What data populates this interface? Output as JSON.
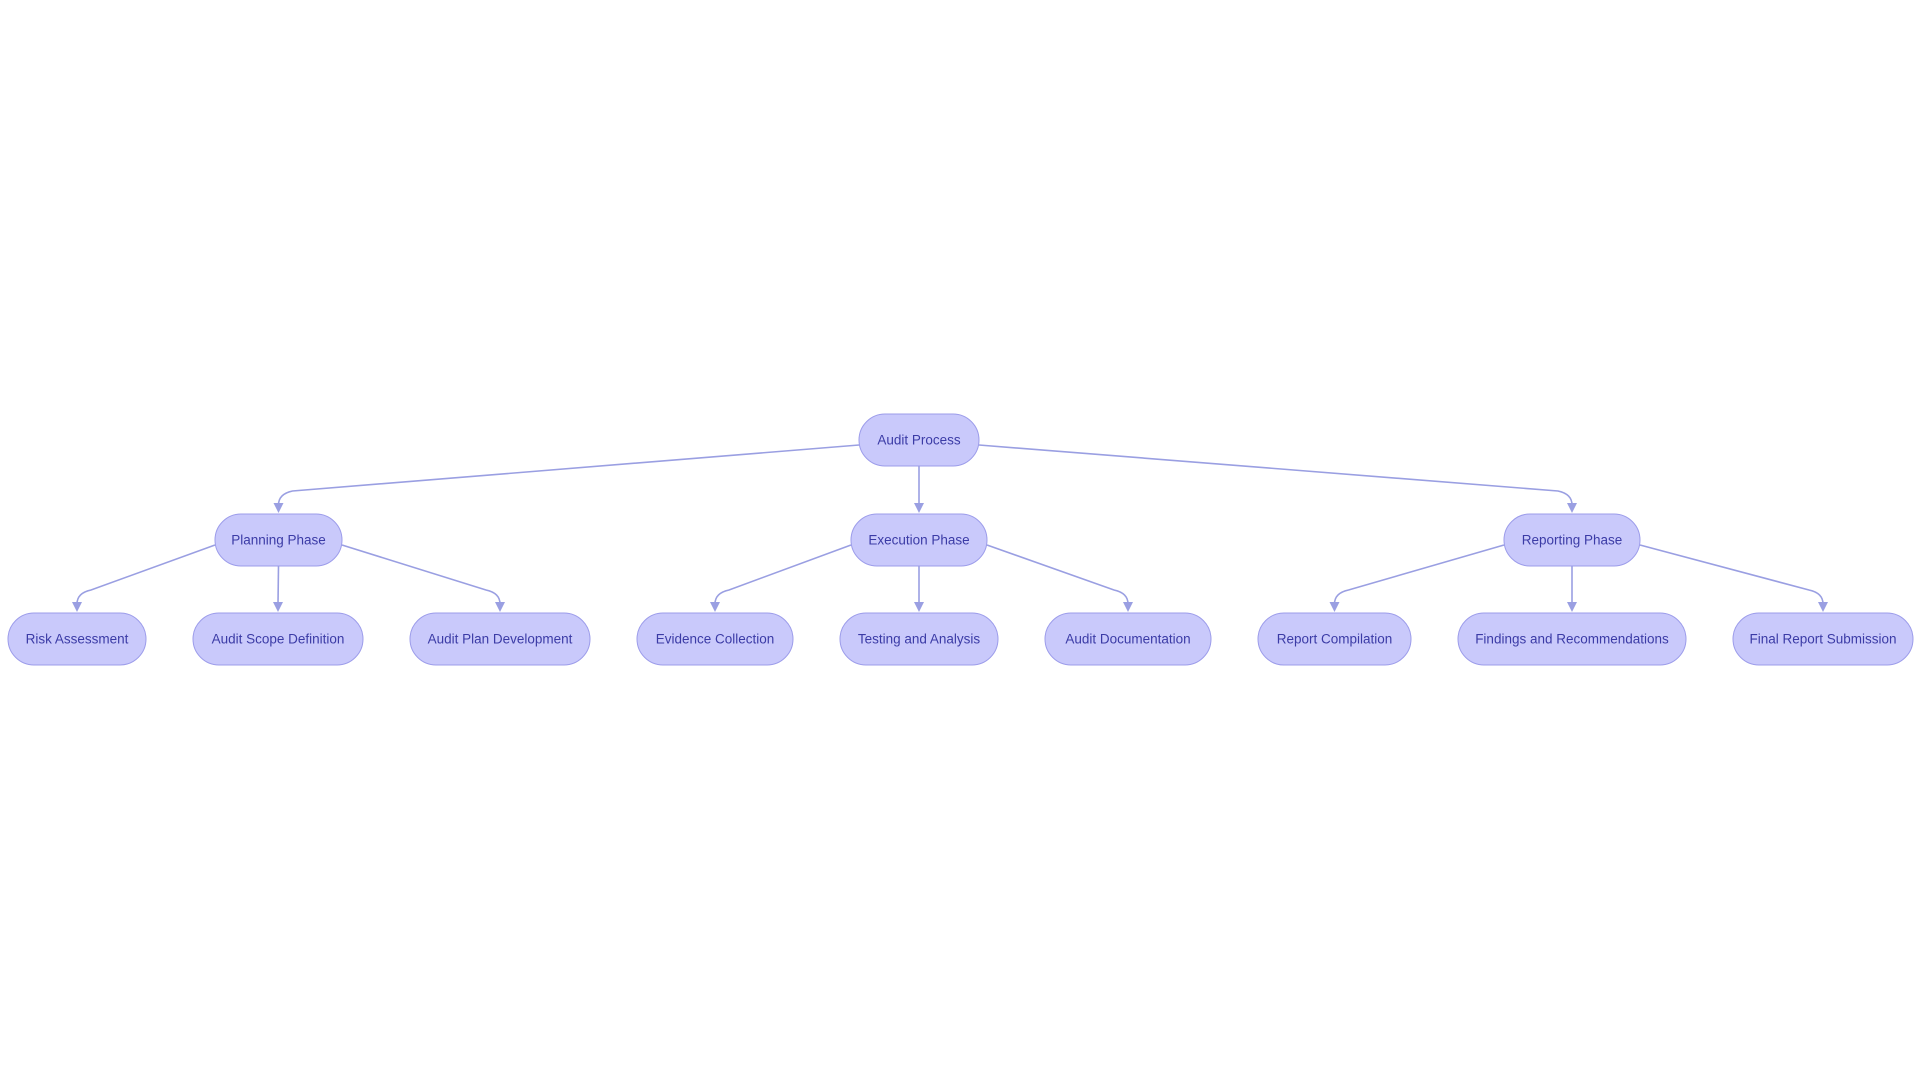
{
  "diagram": {
    "type": "flowchart-tree",
    "colors": {
      "node_fill": "#c9c9fb",
      "node_stroke": "#9c9cea",
      "node_text": "#3b3ba6",
      "edge": "#9a9fe2",
      "background": "#ffffff"
    },
    "root": {
      "id": "audit",
      "label": "Audit Process"
    },
    "phases": [
      {
        "id": "planning",
        "label": "Planning Phase",
        "children": [
          {
            "id": "risk",
            "label": "Risk Assessment"
          },
          {
            "id": "scope",
            "label": "Audit Scope Definition"
          },
          {
            "id": "plan",
            "label": "Audit Plan Development"
          }
        ]
      },
      {
        "id": "execution",
        "label": "Execution Phase",
        "children": [
          {
            "id": "evidence",
            "label": "Evidence Collection"
          },
          {
            "id": "testing",
            "label": "Testing and Analysis"
          },
          {
            "id": "documentation",
            "label": "Audit Documentation"
          }
        ]
      },
      {
        "id": "reporting",
        "label": "Reporting Phase",
        "children": [
          {
            "id": "compilation",
            "label": "Report Compilation"
          },
          {
            "id": "findings",
            "label": "Findings and Recommendations"
          },
          {
            "id": "final",
            "label": "Final Report Submission"
          }
        ]
      }
    ],
    "edges": [
      [
        "audit",
        "planning"
      ],
      [
        "audit",
        "execution"
      ],
      [
        "audit",
        "reporting"
      ],
      [
        "planning",
        "risk"
      ],
      [
        "planning",
        "scope"
      ],
      [
        "planning",
        "plan"
      ],
      [
        "execution",
        "evidence"
      ],
      [
        "execution",
        "testing"
      ],
      [
        "execution",
        "documentation"
      ],
      [
        "reporting",
        "compilation"
      ],
      [
        "reporting",
        "findings"
      ],
      [
        "reporting",
        "final"
      ]
    ]
  }
}
